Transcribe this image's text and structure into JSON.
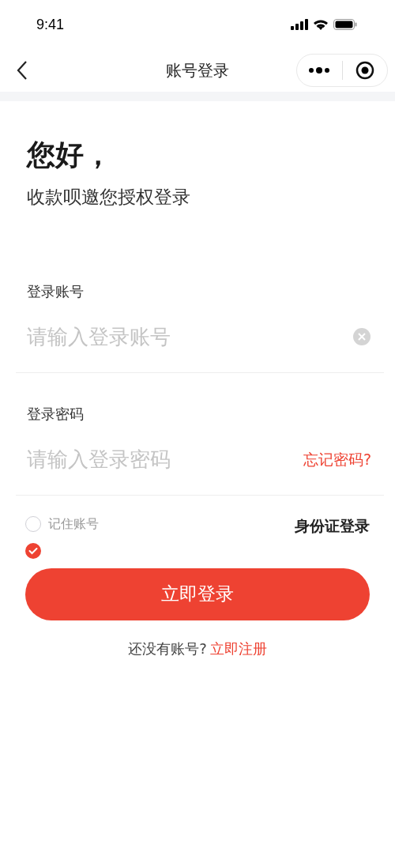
{
  "status_bar": {
    "time": "9:41"
  },
  "nav": {
    "title": "账号登录"
  },
  "greeting": {
    "title": "您好，",
    "subtitle": "收款呗邀您授权登录"
  },
  "fields": [
    {
      "label": "登录账号",
      "placeholder": "请输入登录账号",
      "kind": "clear"
    },
    {
      "label": "登录密码",
      "placeholder": "请输入登录密码",
      "kind": "forgot",
      "action": "忘记密码?"
    }
  ],
  "remember": {
    "label": "记住账号",
    "checked": false
  },
  "extra_check": {
    "checked": true
  },
  "id_login": "身份证登录",
  "submit": "立即登录",
  "register": {
    "text": "还没有账号?",
    "link": "立即注册"
  }
}
